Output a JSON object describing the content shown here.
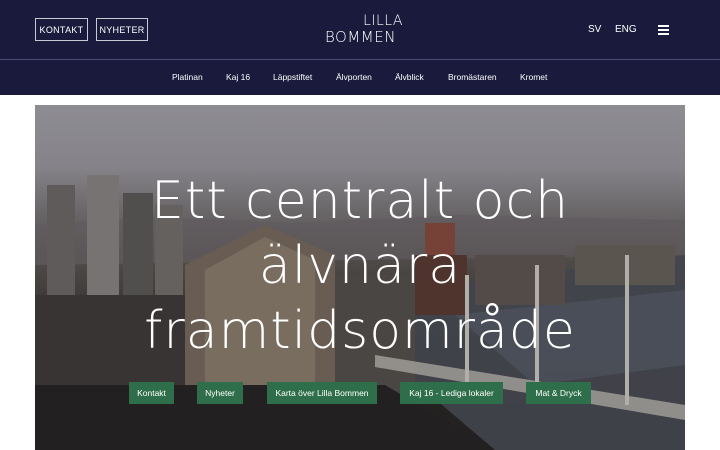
{
  "header": {
    "buttons": {
      "kontakt": "KONTAKT",
      "nyheter": "NYHETER"
    },
    "logo": {
      "line1": "LILLA",
      "line2": "BOMMEN"
    },
    "languages": {
      "sv": "SV",
      "eng": "ENG"
    },
    "menu_icon": "hamburger-icon"
  },
  "nav": {
    "items": [
      "Platinan",
      "Kaj 16",
      "Läppstiftet",
      "Älvporten",
      "Älvblick",
      "Bromästaren",
      "Kromet"
    ]
  },
  "hero": {
    "title_lines": [
      "Ett centralt och",
      "älvnära",
      "framtidsområde"
    ],
    "buttons": [
      "Kontakt",
      "Nyheter",
      "Karta över Lilla Bommen",
      "Kaj 16 - Lediga lokaler",
      "Mat & Dryck"
    ]
  },
  "colors": {
    "header_bg": "#1a1a3c",
    "button_green": "#2f6e4a"
  }
}
